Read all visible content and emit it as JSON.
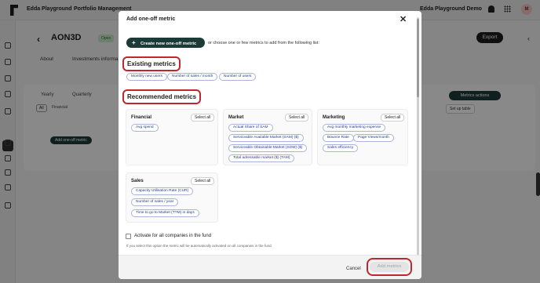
{
  "app": {
    "workspace": "Edda Playground",
    "section": "Portfolio Management",
    "workspace_right": "Edda Playground Demo",
    "avatar_initial": "M"
  },
  "company": {
    "back_icon": "chevron-left-icon",
    "name": "AON3D",
    "status": "Open",
    "tabs": [
      "About",
      "Investments informa"
    ],
    "export_label": "Export",
    "period_tabs": [
      "Yearly",
      "Quarterly"
    ],
    "filter_all": "All",
    "filter_financial": "Financial",
    "metrics_actions_label": "Metrics actions",
    "setup_table_label": "Set up table",
    "add_oneoff_label": "Add one-off metric"
  },
  "modal": {
    "title": "Add one-off metric",
    "close_icon": "close-icon",
    "create_button": "Create new one-off metric",
    "or_text": "or choose one or few metrics to add from the following list:",
    "existing_title": "Existing metrics",
    "existing_metrics": [
      "Monthly new users",
      "Number of sales / month",
      "Number of users"
    ],
    "recommended_title": "Recommended metrics",
    "select_all_label": "Select all",
    "categories": {
      "financial": {
        "title": "Financial",
        "metrics": [
          "Avg spend"
        ]
      },
      "market": {
        "title": "Market",
        "metrics": [
          "Actual Share of SAM",
          "Serviceable Available Market (SAM) ($)",
          "Serviceable Obtainable Market (SOM) ($)",
          "Total adressable market ($) (TAM)"
        ]
      },
      "marketing": {
        "title": "Marketing",
        "metrics": [
          "Avg monthly marketing expense",
          "Bounce Rate",
          "Page Views/month",
          "Sales efficiency"
        ]
      },
      "sales": {
        "title": "Sales",
        "metrics": [
          "Capacity Utilisation Rate (CUR)",
          "Number of sales / year",
          "Time to go to Market (TTM) in days"
        ]
      }
    },
    "activate_label": "Activate for all companies in the fund",
    "hint": "If you select this option the metric will be automatically activated on all companies in the fund",
    "cancel_label": "Cancel",
    "add_label": "Add metrics",
    "highlight_color": "#c0262d",
    "brand_color": "#1c3b37"
  }
}
